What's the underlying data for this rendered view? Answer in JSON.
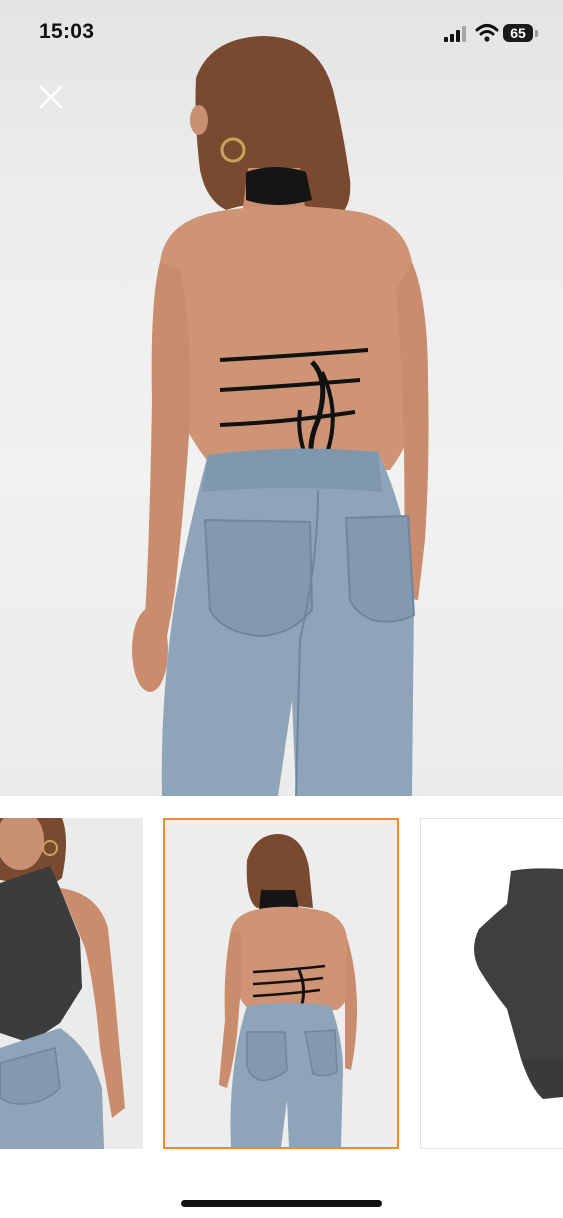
{
  "status_bar": {
    "time": "15:03",
    "battery_level": "65"
  },
  "icons": {
    "close": "close-icon",
    "signal": "cellular-signal-icon",
    "wifi": "wifi-icon",
    "battery": "battery-icon"
  },
  "gallery": {
    "thumbnail_count": 3,
    "selected_index": 2,
    "selected_border_color": "#f08a2c"
  }
}
